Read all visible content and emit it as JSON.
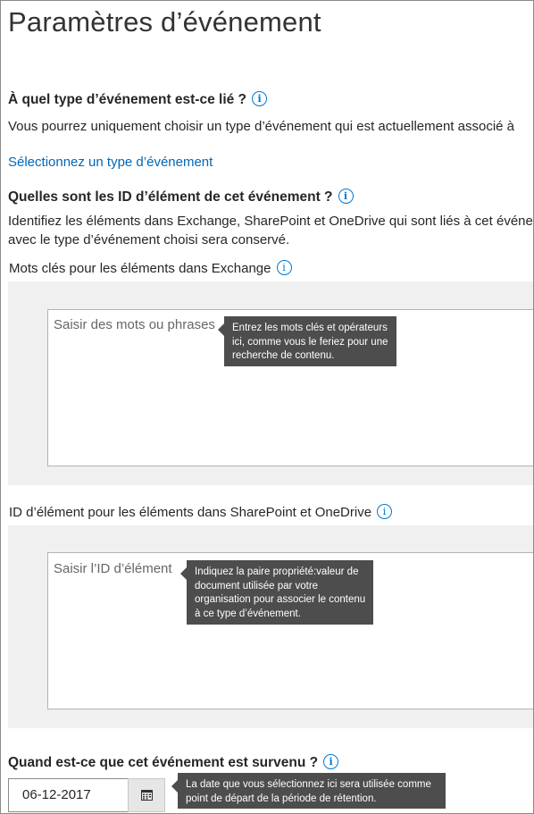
{
  "page": {
    "title": "Paramètres d’événement"
  },
  "event_type": {
    "heading": "À quel type d’événement est-ce lié ?",
    "description": "Vous pourrez uniquement choisir un type d’événement qui est actuellement associé à",
    "link": "Sélectionnez un type d’événement"
  },
  "item_ids": {
    "heading": "Quelles sont les ID d’élément de cet événement ?",
    "description_line1": "Identifiez les éléments dans Exchange, SharePoint et OneDrive qui sont liés à cet événe",
    "description_line2": "avec le type d’événement choisi sera conservé."
  },
  "exchange": {
    "label": "Mots clés pour les éléments dans Exchange",
    "placeholder": "Saisir des mots ou phrases",
    "tooltip": [
      "Entrez les mots clés et opérateurs",
      "ici, comme vous le feriez pour une",
      "recherche de contenu."
    ]
  },
  "sharepoint": {
    "label": "ID d’élément pour les éléments dans SharePoint et OneDrive",
    "placeholder": "Saisir l’ID d’élément",
    "tooltip": [
      "Indiquez la paire propriété:valeur de",
      "document utilisée par votre",
      "organisation pour associer le contenu",
      "à ce type d’événement."
    ]
  },
  "date": {
    "heading": "Quand est-ce que cet événement est survenu ?",
    "value": "06-12-2017",
    "tooltip": [
      "La date que vous sélectionnez ici sera utilisée comme",
      "point de départ de la période de rétention."
    ]
  },
  "icons": {
    "info": "info-icon",
    "calendar": "calendar-icon"
  },
  "colors": {
    "link": "#0067b8",
    "info_icon": "#0078d4",
    "tooltip_bg": "#4d4d4d",
    "panel_bg": "#f0f0f0"
  }
}
